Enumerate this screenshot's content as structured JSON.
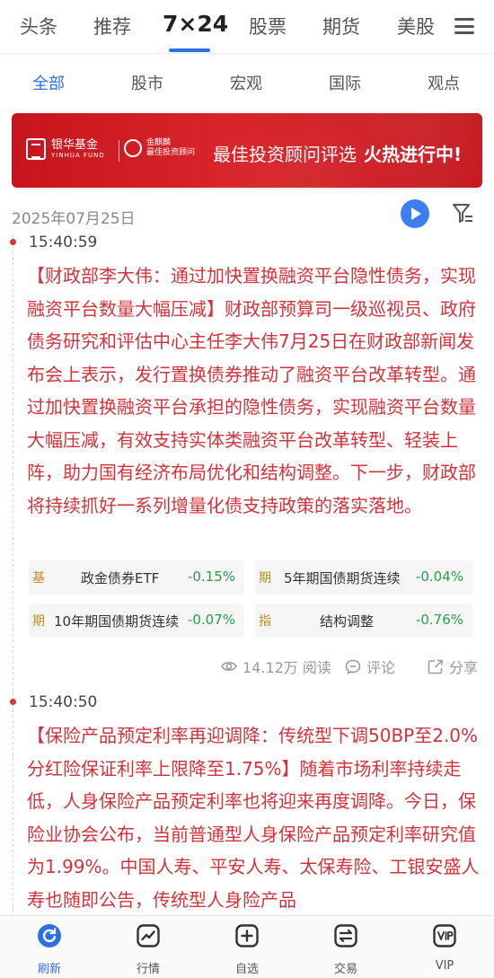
{
  "top_tabs": [
    "头条",
    "推荐",
    "7×24",
    "股票",
    "期货",
    "美股"
  ],
  "sub_tabs": [
    "全部",
    "股市",
    "宏观",
    "国际",
    "观点"
  ],
  "banner": {
    "brand1": "银华基金",
    "brand1_sub": "YINHUA FUND",
    "brand2_line1": "金麒麟",
    "brand2_line2": "最佳投资顾问",
    "slogan": "最佳投资顾问评选",
    "slogan_bold": "火热进行中!"
  },
  "date": "2025年07月25日",
  "news": [
    {
      "time": "15:40:59",
      "headline": "【财政部李大伟：通过加快置换融资平台隐性债务，实现融资平台数量大幅压减】",
      "body": "财政部预算司一级巡视员、政府债务研究和评估中心主任李大伟7月25日在财政部新闻发布会上表示，发行置换债券推动了融资平台改革转型。通过加快置换融资平台承担的隐性债务，实现融资平台数量大幅压减，有效支持实体类融资平台改革转型、轻装上阵，助力国有经济布局优化和结构调整。下一步，财政部将持续抓好一系列增量化债支持政策的落实落地。",
      "chips": [
        {
          "tag": "基",
          "name": "政金债券ETF",
          "change": "-0.15%"
        },
        {
          "tag": "期",
          "name": "5年期国债期货连续",
          "change": "-0.04%"
        },
        {
          "tag": "期",
          "name": "10年期国债期货连续",
          "change": "-0.07%"
        },
        {
          "tag": "指",
          "name": "结构调整",
          "change": "-0.76%"
        }
      ],
      "reads": "14.12万 阅读",
      "comment": "评论",
      "share": "分享"
    },
    {
      "time": "15:40:50",
      "headline": "【保险产品预定利率再迎调降：传统型下调50BP至2.0% 分红险保证利率上限降至1.75%】",
      "body": "随着市场利率持续走低，人身保险产品预定利率也将迎来再度调降。今日，保险业协会公布，当前普通型人身保险产品预定利率研究值为1.99%。中国人寿、平安人寿、太保寿险、工银安盛人寿也随即公告，传统型人身险产品"
    }
  ],
  "bottom_nav": [
    {
      "label": "刷新",
      "icon": "refresh-icon"
    },
    {
      "label": "行情",
      "icon": "chart-line-icon"
    },
    {
      "label": "自选",
      "icon": "plus-square-icon"
    },
    {
      "label": "交易",
      "icon": "exchange-icon"
    },
    {
      "label": "VIP",
      "icon": "vip-icon"
    }
  ],
  "colors": {
    "accent": "#2f6fe4",
    "news_red": "#d3323b",
    "down_green": "#2a9d4b",
    "banner_red": "#d9242a"
  }
}
